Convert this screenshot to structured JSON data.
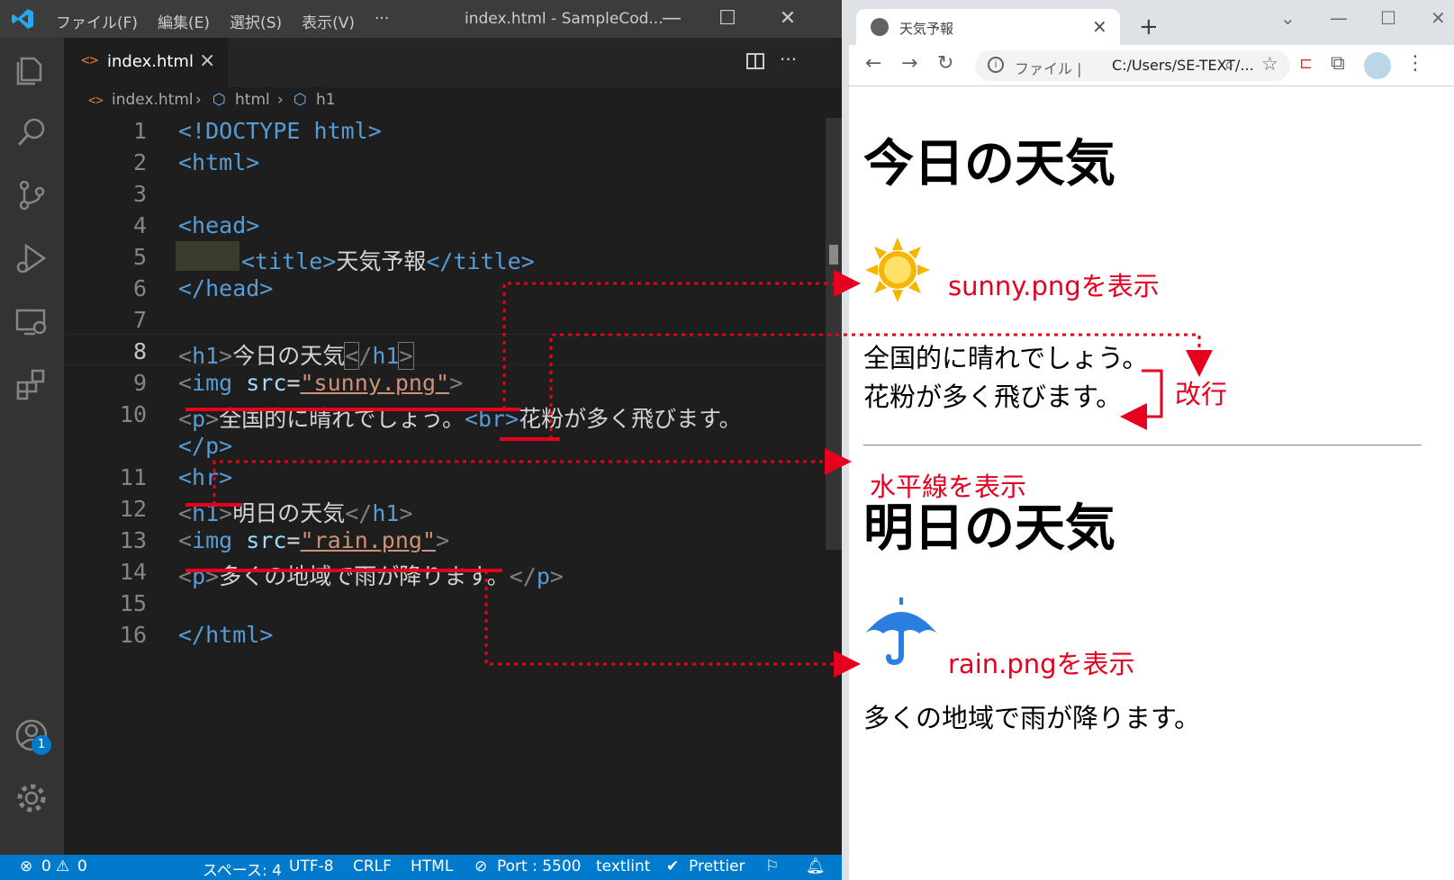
{
  "vscode": {
    "menu": [
      "ファイル(F)",
      "編集(E)",
      "選択(S)",
      "表示(V)",
      "···"
    ],
    "window_title": "index.html - SampleCod...",
    "tab_label": "index.html",
    "breadcrumb": [
      "index.html",
      "html",
      "h1"
    ],
    "line_numbers": [
      "1",
      "2",
      "3",
      "4",
      "5",
      "6",
      "7",
      "8",
      "9",
      "10",
      "11",
      "12",
      "13",
      "14",
      "15",
      "16"
    ],
    "code": {
      "l1": "<!DOCTYPE html>",
      "l2": "<html>",
      "l4": "<head>",
      "l5_tag_open": "<title>",
      "l5_text": "天気予報",
      "l5_tag_close": "</title>",
      "l6": "</head>",
      "l8_text": "今日の天気",
      "l9_src": "\"sunny.png\"",
      "l10_text1": "全国的に晴れでしょう。",
      "l10_br": "<br>",
      "l10_text2": "花粉が多く飛びます。",
      "l10b": "</p>",
      "l11": "<hr>",
      "l12_text": "明日の天気",
      "l13_src": "\"rain.png\"",
      "l14_text": "多くの地域で雨が降ります。",
      "l16": "</html>"
    },
    "status": {
      "errors": "0",
      "warnings": "0",
      "spaces": "スペース: 4",
      "encoding": "UTF-8",
      "eol": "CRLF",
      "language": "HTML",
      "port": "Port : 5500",
      "linter": "textlint",
      "formatter": "Prettier",
      "badge": "1"
    }
  },
  "chrome": {
    "tab_title": "天気予報",
    "omnibox_scheme": "ファイル",
    "omnibox_url": "C:/Users/SE-TEXT/...",
    "page": {
      "h1_today": "今日の天気",
      "p1_line1": "全国的に晴れでしょう。",
      "p1_line2": "花粉が多く飛びます。",
      "h1_tomorrow": "明日の天気",
      "p2": "多くの地域で雨が降ります。"
    }
  },
  "annotations": {
    "sunny": "sunny.pngを表示",
    "br": "改行",
    "hr": "水平線を表示",
    "rain": "rain.pngを表示"
  },
  "colors": {
    "annotation_red": "#e6001e",
    "statusbar_blue": "#007acc",
    "sun_yellow": "#f7b500",
    "umbrella_blue": "#2a7ee0"
  },
  "icons": [
    "vscode-logo-icon",
    "explorer-icon",
    "search-icon",
    "source-control-icon",
    "run-debug-icon",
    "remote-explorer-icon",
    "extensions-icon",
    "account-icon",
    "settings-gear-icon",
    "split-editor-icon",
    "more-actions-icon",
    "html-file-icon",
    "element-icon",
    "error-icon",
    "warning-icon",
    "no-port-icon",
    "check-icon",
    "feedback-icon",
    "bell-icon",
    "globe-icon",
    "back-icon",
    "forward-icon",
    "reload-icon",
    "info-icon",
    "zoom-icon",
    "star-icon",
    "extension-puzzle-icon",
    "profile-avatar-icon",
    "sun-image",
    "umbrella-image"
  ]
}
